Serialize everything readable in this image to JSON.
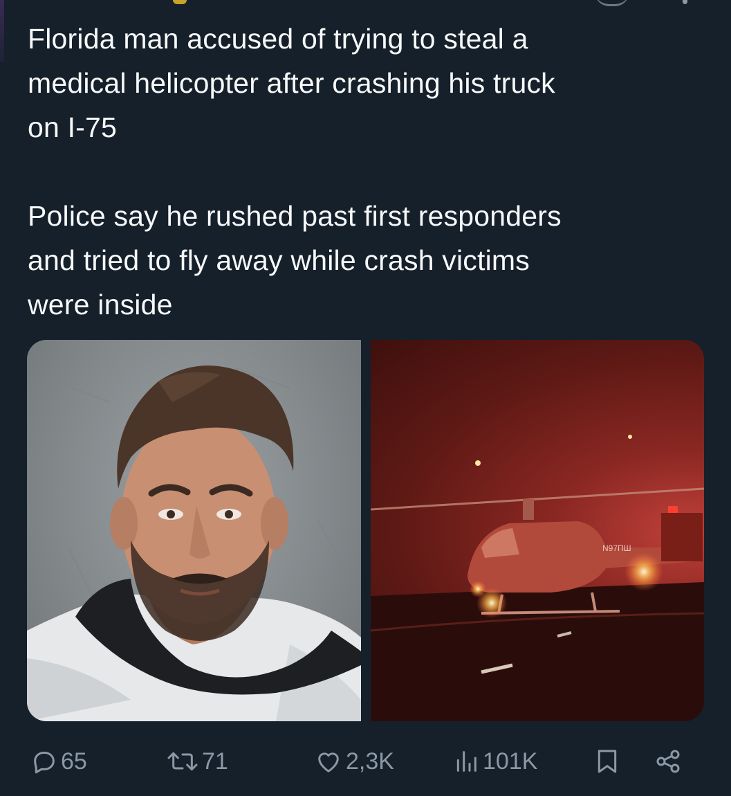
{
  "tweet": {
    "text": "Florida man accused of trying to steal a\nmedical helicopter after crashing his truck\non I-75\n\nPolice say he rushed past first responders\nand tried to fly away while crash victims\nwere inside"
  },
  "media": {
    "left_photo": "mugshot",
    "right_photo": "helicopter-at-night",
    "helicopter_tail_text": "N97ПШ"
  },
  "actions": {
    "reply": {
      "icon": "reply-icon",
      "count": "65"
    },
    "retweet": {
      "icon": "retweet-icon",
      "count": "71"
    },
    "like": {
      "icon": "heart-icon",
      "count": "2,3K"
    },
    "views": {
      "icon": "views-icon",
      "count": "101K"
    },
    "bookmark": {
      "icon": "bookmark-icon"
    },
    "share": {
      "icon": "share-icon"
    }
  },
  "colors": {
    "background": "#15202b",
    "text": "#f7f9f9",
    "muted": "#8b98a5"
  }
}
